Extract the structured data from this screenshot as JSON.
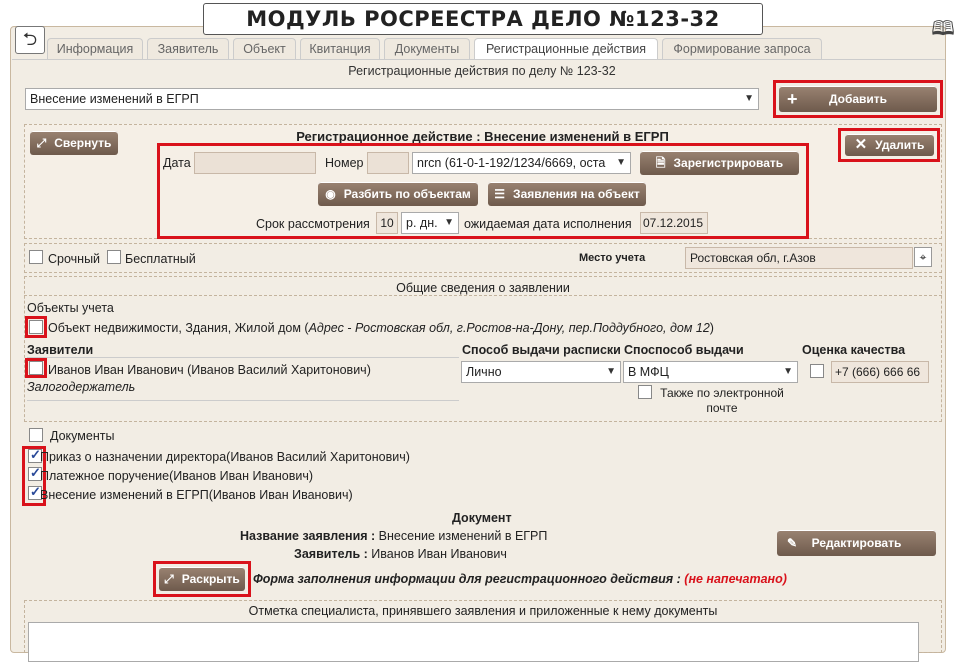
{
  "title": "МОДУЛЬ РОСРЕЕСТРА ДЕЛО №123-32",
  "tabs": [
    "Информация",
    "Заявитель",
    "Объект",
    "Квитанция",
    "Документы",
    "Регистрационные действия",
    "Формирование запроса"
  ],
  "header_caption": "Регистрационные действия по делу № 123-32",
  "action_select": "Внесение изменений в ЕГРП",
  "add_button": "Добавить",
  "collapse_button": "Свернуть",
  "delete_button": "Удалить",
  "reg_title": "Регистрационное действие : Внесение изменений в ЕГРП",
  "date_label": "Дата",
  "number_label": "Номер",
  "nrcn_select": "nrcn (61-0-1-192/1234/6669, оста",
  "register_button": "Зарегистрировать",
  "split_button": "Разбить по объектам",
  "applications_button": "Заявления на объект",
  "term_label": "Срок рассмотрения",
  "term_value": "10",
  "term_unit": "р. дн.",
  "expected_label": "ожидаемая дата исполнения",
  "expected_date": "07.12.2015",
  "urgent_label": "Срочный",
  "free_label": "Бесплатный",
  "place_label": "Место учета",
  "place_value": "Ростовская обл,  г.Азов",
  "general_info": "Общие сведения о заявлении",
  "objects_label": "Объекты учета",
  "object_text": "Объект недвижимости, Здания, Жилой дом (",
  "object_address": "Адрес - Ростовская обл, г.Ростов-на-Дону, пер.Поддубного, дом 12",
  "object_close": ")",
  "applicants_header": "Заявители",
  "receipt_method_header": "Способ выдачи расписки",
  "issue_method_header": "Споспособ выдачи",
  "quality_header": "Оценка качества",
  "applicant_name": "Иванов Иван Иванович (Иванов Василий Харитонович)",
  "applicant_role": "Залогодержатель",
  "receipt_method": "Лично",
  "issue_method": "В МФЦ",
  "also_email": "Также по электронной почте",
  "phone": "+7 (666) 666 66",
  "documents_label": "Документы",
  "documents": [
    "Приказ о назначении директора(Иванов Василий Харитонович)",
    "Платежное поручение(Иванов Иван Иванович)",
    "Внесение изменений в ЕГРП(Иванов Иван Иванович)"
  ],
  "document_header": "Документ",
  "app_name_label": "Название заявления :",
  "app_name_value": "Внесение изменений в ЕГРП",
  "applicant_label": "Заявитель :",
  "applicant_value": "Иванов Иван Иванович",
  "edit_button": "Редактировать",
  "expand_button": "Раскрыть",
  "form_label": "Форма заполнения информации для регистрационного действия :",
  "form_status": "(не напечатано)",
  "specialist_note": "Отметка специалиста, принявшего заявления и приложенные к нему документы",
  "accent_red": "#d9121b",
  "button_brown": "#7d6858"
}
